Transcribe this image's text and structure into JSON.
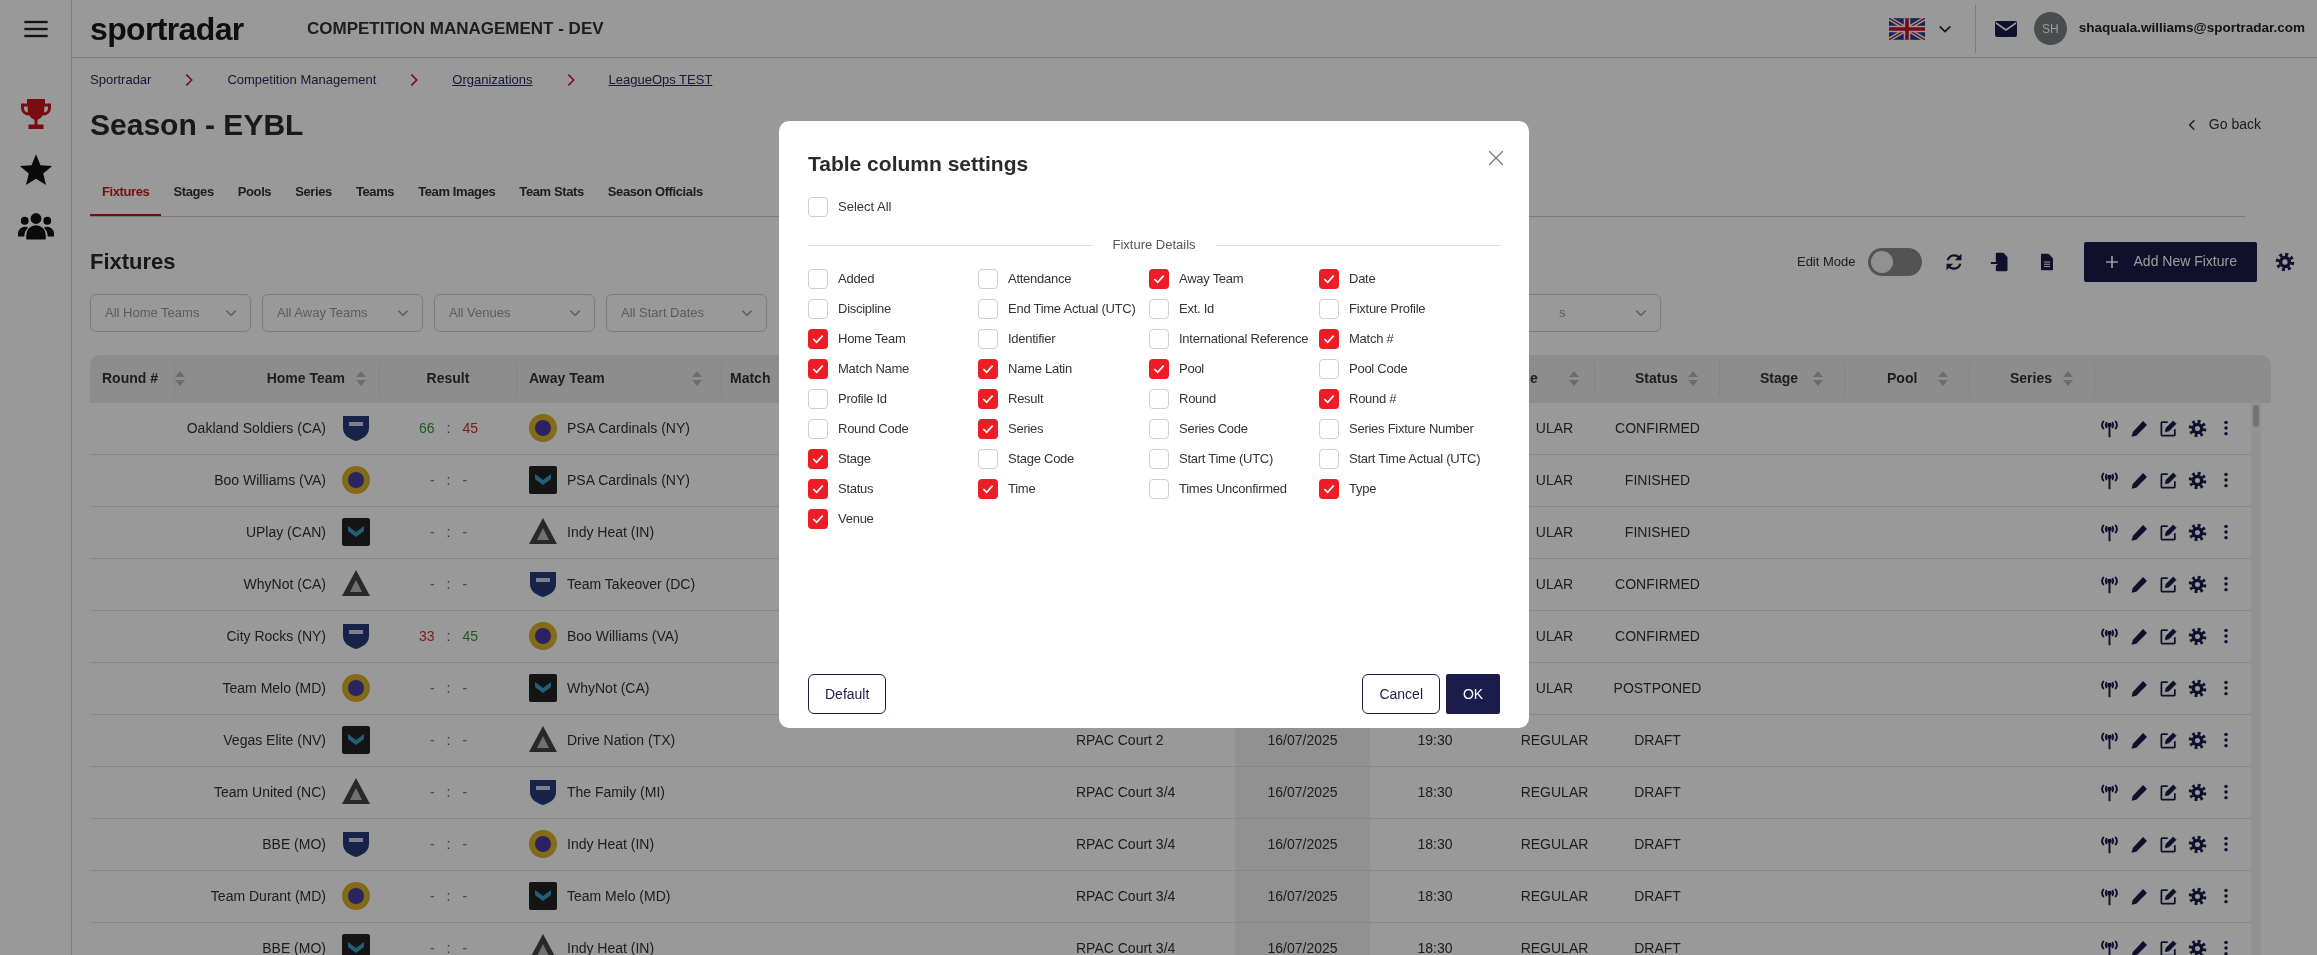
{
  "header": {
    "logo": "sportradar",
    "title": "COMPETITION MANAGEMENT - DEV",
    "user_initials": "SH",
    "user_email": "shaquala.williams@sportradar.com"
  },
  "sidebar": {
    "items": [
      {
        "kind": "trophy",
        "selected": true
      },
      {
        "kind": "star",
        "selected": false
      },
      {
        "kind": "users",
        "selected": false
      }
    ]
  },
  "breadcrumbs": [
    {
      "label": "Sportradar",
      "link": false
    },
    {
      "label": "Competition Management",
      "link": false
    },
    {
      "label": "Organizations",
      "link": true
    },
    {
      "label": "LeagueOps TEST",
      "link": true
    }
  ],
  "page_title": "Season - EYBL",
  "go_back": "Go back",
  "tabs": [
    {
      "label": "Fixtures",
      "selected": true
    },
    {
      "label": "Stages",
      "selected": false
    },
    {
      "label": "Pools",
      "selected": false
    },
    {
      "label": "Series",
      "selected": false
    },
    {
      "label": "Teams",
      "selected": false
    },
    {
      "label": "Team Images",
      "selected": false
    },
    {
      "label": "Team Stats",
      "selected": false
    },
    {
      "label": "Season Officials",
      "selected": false
    }
  ],
  "section_title": "Fixtures",
  "toolbar": {
    "edit_mode_label": "Edit Mode",
    "edit_mode_on": false,
    "add_button": "Add New Fixture"
  },
  "filters": [
    {
      "placeholder": "All Home Teams"
    },
    {
      "placeholder": "All Away Teams"
    },
    {
      "placeholder": "All Venues"
    },
    {
      "placeholder": "All Start Dates"
    }
  ],
  "filter_partial": {
    "placeholder": "s"
  },
  "table": {
    "columns_left": [
      {
        "label": "Round #",
        "sortable": true
      },
      {
        "label": "Home Team",
        "sortable": true
      },
      {
        "label": "Result",
        "sortable": false
      },
      {
        "label": "Away Team",
        "sortable": true
      },
      {
        "label": "Match",
        "sortable": false
      }
    ],
    "columns_right": [
      {
        "label": "e",
        "sortable": true
      },
      {
        "label": "Status",
        "sortable": true
      },
      {
        "label": "Stage",
        "sortable": true
      },
      {
        "label": "Pool",
        "sortable": true
      },
      {
        "label": "Series",
        "sortable": true
      }
    ],
    "rows": [
      {
        "home": "Oakland Soldiers (CA)",
        "home_score": "66",
        "separator": ":",
        "away_score": "45",
        "home_won": true,
        "away_won": false,
        "away": "PSA Cardinals (NY)",
        "type": "ULAR",
        "status": "CONFIRMED"
      },
      {
        "home": "Boo Williams (VA)",
        "home_score": "-",
        "separator": ":",
        "away_score": "-",
        "away": "PSA Cardinals (NY)",
        "type": "ULAR",
        "status": "FINISHED"
      },
      {
        "home": "UPlay (CAN)",
        "home_score": "-",
        "separator": ":",
        "away_score": "-",
        "away": "Indy Heat (IN)",
        "type": "ULAR",
        "status": "FINISHED"
      },
      {
        "home": "WhyNot (CA)",
        "home_score": "-",
        "separator": ":",
        "away_score": "-",
        "away": "Team Takeover (DC)",
        "type": "ULAR",
        "status": "CONFIRMED"
      },
      {
        "home": "City Rocks (NY)",
        "home_score": "33",
        "separator": ":",
        "away_score": "45",
        "home_won": false,
        "away_won": true,
        "away": "Boo Williams (VA)",
        "type": "ULAR",
        "status": "CONFIRMED"
      },
      {
        "home": "Team Melo (MD)",
        "home_score": "-",
        "separator": ":",
        "away_score": "-",
        "away": "WhyNot (CA)",
        "type": "ULAR",
        "status": "POSTPONED"
      },
      {
        "home": "Vegas Elite (NV)",
        "home_score": "-",
        "separator": ":",
        "away_score": "-",
        "away": "Drive Nation (TX)",
        "venue": "RPAC Court 2",
        "date": "16/07/2025",
        "time": "19:30",
        "type": "REGULAR",
        "status": "DRAFT"
      },
      {
        "home": "Team United (NC)",
        "home_score": "-",
        "separator": ":",
        "away_score": "-",
        "away": "The Family (MI)",
        "venue": "RPAC Court 3/4",
        "date": "16/07/2025",
        "time": "18:30",
        "type": "REGULAR",
        "status": "DRAFT"
      },
      {
        "home": "BBE (MO)",
        "home_score": "-",
        "separator": ":",
        "away_score": "-",
        "away": "Indy Heat (IN)",
        "venue": "RPAC Court 3/4",
        "date": "16/07/2025",
        "time": "18:30",
        "type": "REGULAR",
        "status": "DRAFT"
      },
      {
        "home": "Team Durant (MD)",
        "home_score": "-",
        "separator": ":",
        "away_score": "-",
        "away": "Team Melo (MD)",
        "venue": "RPAC Court 3/4",
        "date": "16/07/2025",
        "time": "18:30",
        "type": "REGULAR",
        "status": "DRAFT"
      },
      {
        "home": "BBE (MO)",
        "home_score": "-",
        "separator": ":",
        "away_score": "-",
        "away": "Indy Heat (IN)",
        "venue": "RPAC Court 3/4",
        "date": "16/07/2025",
        "time": "18:30",
        "type": "REGULAR",
        "status": "DRAFT"
      }
    ]
  },
  "modal": {
    "title": "Table column settings",
    "select_all": {
      "label": "Select All",
      "checked": false
    },
    "section": "Fixture Details",
    "options": [
      {
        "label": "Added",
        "checked": false
      },
      {
        "label": "Attendance",
        "checked": false
      },
      {
        "label": "Away Team",
        "checked": true
      },
      {
        "label": "Date",
        "checked": true
      },
      {
        "label": "Discipline",
        "checked": false
      },
      {
        "label": "End Time Actual (UTC)",
        "checked": false
      },
      {
        "label": "Ext. Id",
        "checked": false
      },
      {
        "label": "Fixture Profile",
        "checked": false
      },
      {
        "label": "Home Team",
        "checked": true
      },
      {
        "label": "Identifier",
        "checked": false
      },
      {
        "label": "International Reference",
        "checked": false
      },
      {
        "label": "Match #",
        "checked": true
      },
      {
        "label": "Match Name",
        "checked": true
      },
      {
        "label": "Name Latin",
        "checked": true
      },
      {
        "label": "Pool",
        "checked": true
      },
      {
        "label": "Pool Code",
        "checked": false
      },
      {
        "label": "Profile Id",
        "checked": false
      },
      {
        "label": "Result",
        "checked": true
      },
      {
        "label": "Round",
        "checked": false
      },
      {
        "label": "Round #",
        "checked": true
      },
      {
        "label": "Round Code",
        "checked": false
      },
      {
        "label": "Series",
        "checked": true
      },
      {
        "label": "Series Code",
        "checked": false
      },
      {
        "label": "Series Fixture Number",
        "checked": false
      },
      {
        "label": "Stage",
        "checked": true
      },
      {
        "label": "Stage Code",
        "checked": false
      },
      {
        "label": "Start Time (UTC)",
        "checked": false
      },
      {
        "label": "Start Time Actual (UTC)",
        "checked": false
      },
      {
        "label": "Status",
        "checked": true
      },
      {
        "label": "Time",
        "checked": true
      },
      {
        "label": "Times Unconfirmed",
        "checked": false
      },
      {
        "label": "Type",
        "checked": true
      },
      {
        "label": "Venue",
        "checked": true
      }
    ],
    "default_button": "Default",
    "cancel_button": "Cancel",
    "ok_button": "OK"
  }
}
